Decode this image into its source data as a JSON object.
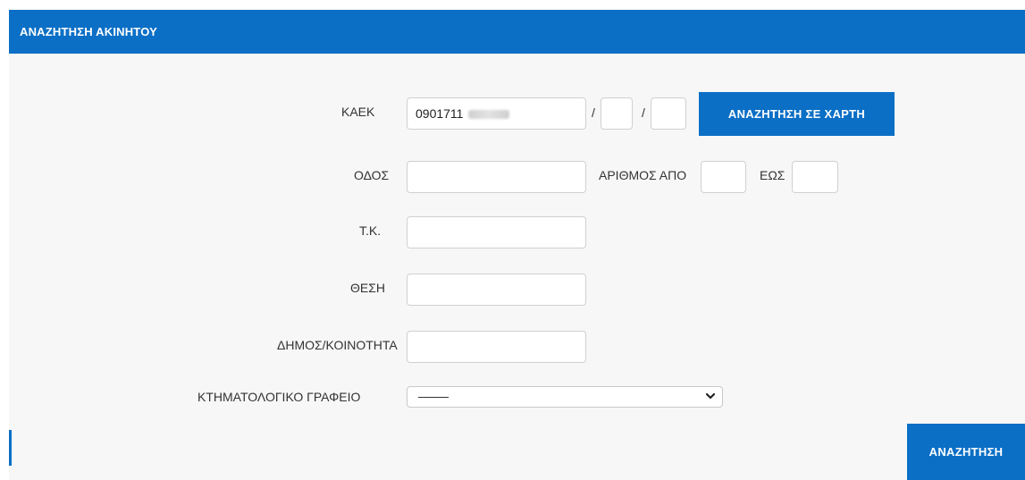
{
  "header": {
    "title": "ΑΝΑΖΗΤΗΣΗ ΑΚΙΝΗΤΟΥ"
  },
  "form": {
    "kaek": {
      "label": "ΚΑΕΚ",
      "value": "0901711",
      "separator": "/",
      "part2": "",
      "part3": ""
    },
    "map_search_button": "ΑΝΑΖΗΤΗΣΗ ΣΕ ΧΑΡΤΗ",
    "street": {
      "label": "ΟΔΟΣ",
      "value": ""
    },
    "number_from": {
      "label": "ΑΡΙΘΜΟΣ ΑΠΟ",
      "value": ""
    },
    "number_to": {
      "label": "ΕΩΣ",
      "value": ""
    },
    "postal_code": {
      "label": "Τ.Κ.",
      "value": ""
    },
    "location": {
      "label": "ΘΕΣΗ",
      "value": ""
    },
    "municipality": {
      "label": "ΔΗΜΟΣ/ΚΟΙΝΟΤΗΤΑ",
      "value": ""
    },
    "office": {
      "label": "ΚΤΗΜΑΤΟΛΟΓΙΚΟ ΓΡΑΦΕΙΟ",
      "selected": "——"
    }
  },
  "search_button": "ΑΝΑΖΗΤΗΣΗ",
  "colors": {
    "accent": "#0b6fc6",
    "panel_bg": "#f7f7f7"
  }
}
